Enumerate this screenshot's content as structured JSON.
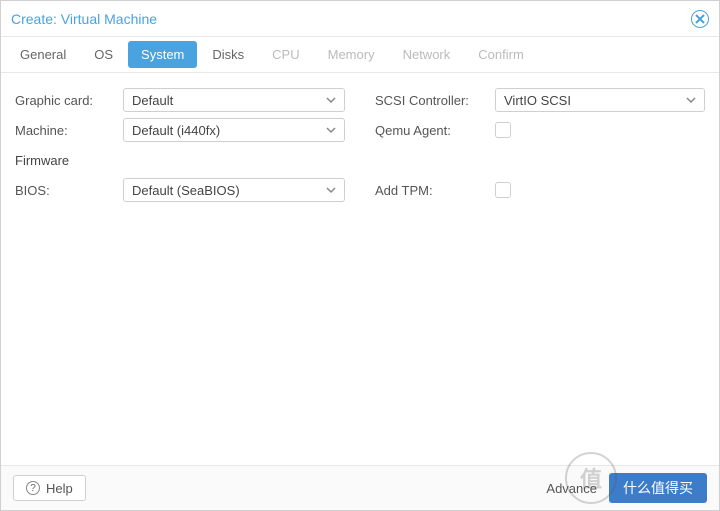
{
  "title": "Create: Virtual Machine",
  "tabs": [
    {
      "label": "General",
      "state": "enabled"
    },
    {
      "label": "OS",
      "state": "enabled"
    },
    {
      "label": "System",
      "state": "active"
    },
    {
      "label": "Disks",
      "state": "enabled"
    },
    {
      "label": "CPU",
      "state": "disabled"
    },
    {
      "label": "Memory",
      "state": "disabled"
    },
    {
      "label": "Network",
      "state": "disabled"
    },
    {
      "label": "Confirm",
      "state": "disabled"
    }
  ],
  "left": {
    "graphic_label": "Graphic card:",
    "graphic_value": "Default",
    "machine_label": "Machine:",
    "machine_value": "Default (i440fx)",
    "firmware_section": "Firmware",
    "bios_label": "BIOS:",
    "bios_value": "Default (SeaBIOS)"
  },
  "right": {
    "scsi_label": "SCSI Controller:",
    "scsi_value": "VirtIO SCSI",
    "qemu_label": "Qemu Agent:",
    "qemu_checked": false,
    "tpm_label": "Add TPM:",
    "tpm_checked": false
  },
  "footer": {
    "help": "Help",
    "advanced": "Advance",
    "action_button": "什么值得买"
  },
  "watermark": "值"
}
